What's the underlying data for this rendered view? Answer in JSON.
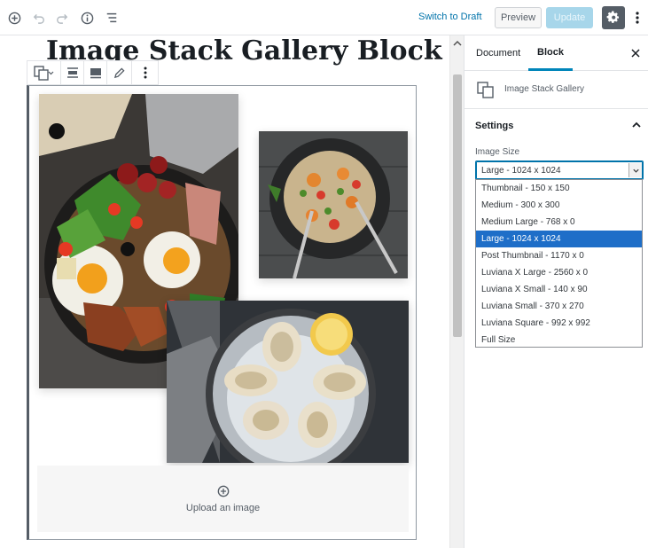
{
  "topbar": {
    "icons": [
      "add-block-icon",
      "undo-icon",
      "redo-icon",
      "info-icon",
      "list-view-icon"
    ],
    "switch_to_draft": "Switch to Draft",
    "preview": "Preview",
    "update": "Update",
    "settings_icon": "gear-icon",
    "more_icon": "more-vertical-icon"
  },
  "editor": {
    "title": "Image Stack Gallery Block",
    "upload_label": "Upload an image",
    "photos": [
      "breakfast-photo",
      "pasta-salad-photo",
      "oysters-photo"
    ]
  },
  "sidebar": {
    "tab_document": "Document",
    "tab_block": "Block",
    "block_name": "Image Stack Gallery",
    "settings_title": "Settings",
    "image_size_label": "Image Size",
    "image_size_value": "Large - 1024 x 1024",
    "options": [
      "Thumbnail - 150 x 150",
      "Medium - 300 x 300",
      "Medium Large - 768 x 0",
      "Large - 1024 x 1024",
      "Post Thumbnail - 1170 x 0",
      "Luviana X Large - 2560 x 0",
      "Luviana X Small - 140 x 90",
      "Luviana Small - 370 x 270",
      "Luviana Square - 992 x 992",
      "Full Size"
    ],
    "selected_index": 3
  },
  "colors": {
    "accent": "#0085ba",
    "link": "#0073aa",
    "selected_option": "#1e6ec8",
    "update_disabled": "#a7d6ea",
    "settings_button": "#555d66"
  }
}
